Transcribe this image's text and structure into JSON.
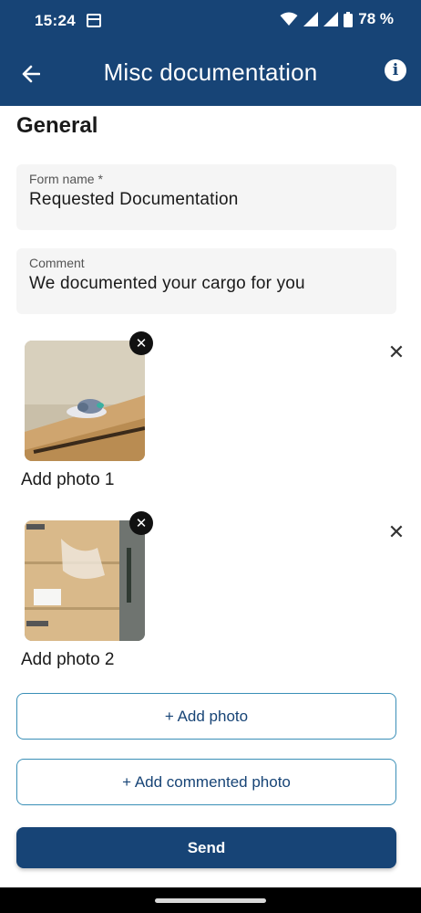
{
  "status_bar": {
    "time": "15:24",
    "battery": "78 %",
    "icons": [
      "calendar-icon",
      "wifi-icon",
      "signal-icon",
      "signal-icon",
      "battery-icon"
    ]
  },
  "app_bar": {
    "title": "Misc documentation",
    "back_icon": "arrow-left-icon",
    "info_icon": "info-icon",
    "info_glyph": "i",
    "color": "#174476"
  },
  "form": {
    "section_title": "General",
    "fields": [
      {
        "label": "Form name  *",
        "value": "Requested Documentation"
      },
      {
        "label": "Comment",
        "value": "We documented your cargo for you"
      }
    ]
  },
  "photos": [
    {
      "label": "Add photo 1",
      "remove_glyph": "✕",
      "delete_glyph": "✕"
    },
    {
      "label": "Add photo 2",
      "remove_glyph": "✕",
      "delete_glyph": "✕"
    }
  ],
  "actions": {
    "add_photo": "+ Add photo",
    "add_commented_photo": "+ Add commented photo",
    "send": "Send",
    "outline_color": "#3a8fb7"
  }
}
